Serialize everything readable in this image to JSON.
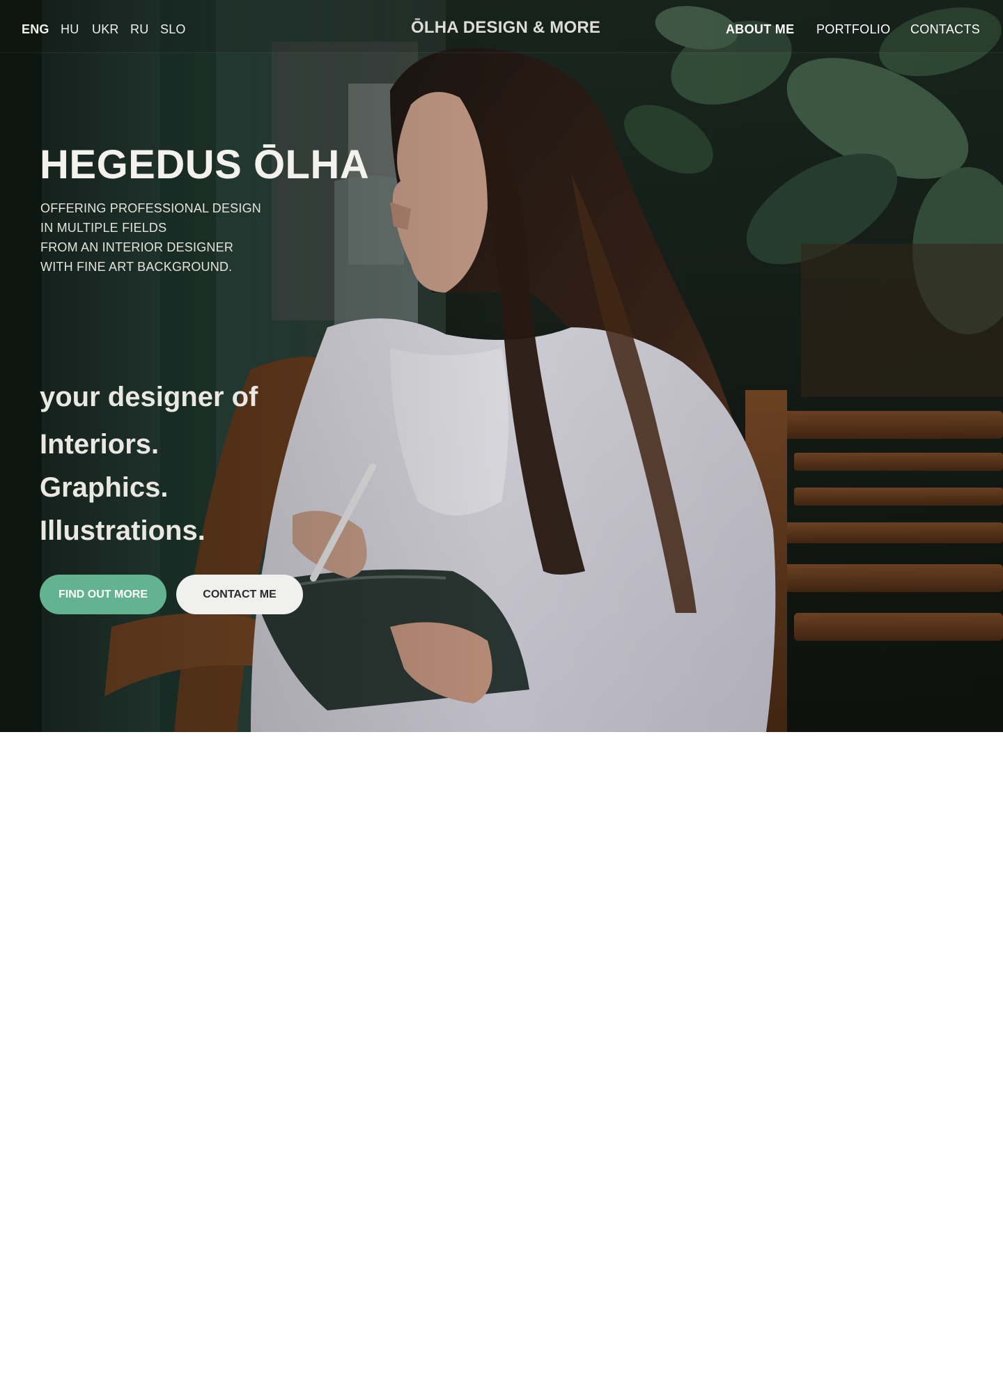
{
  "nav": {
    "languages": [
      {
        "label": "ENG",
        "active": true
      },
      {
        "label": "HU",
        "active": false
      },
      {
        "label": "UKR",
        "active": false
      },
      {
        "label": "RU",
        "active": false
      },
      {
        "label": "SLO",
        "active": false
      }
    ],
    "brand": "ŌLHA DESIGN & MORE",
    "links": [
      {
        "label": "ABOUT ME",
        "active": true
      },
      {
        "label": "PORTFOLIO",
        "active": false
      },
      {
        "label": "CONTACTS",
        "active": false
      }
    ]
  },
  "hero": {
    "title": "HEGEDUS ŌLHA",
    "subtitle_lines": [
      "OFFERING PROFESSIONAL DESIGN",
      "IN MULTIPLE FIELDS",
      "FROM AN INTERIOR DESIGNER",
      "WITH FINE ART BACKGROUND."
    ],
    "tagline": "your designer of",
    "specialties": [
      "Interiors.",
      "Graphics.",
      "Illustrations."
    ],
    "buttons": {
      "primary": "FIND OUT MORE",
      "secondary": "CONTACT ME"
    },
    "background_image": "photo of a woman with long dark hair in a white shirt sitting on a wooden bench, holding a tablet and stylus, with large green plant leaves behind her"
  },
  "colors": {
    "accent": "#63b390",
    "secondary_button": "#f0f0ef",
    "hero_text": "#f3f2ee",
    "page_background": "#ffffff"
  }
}
